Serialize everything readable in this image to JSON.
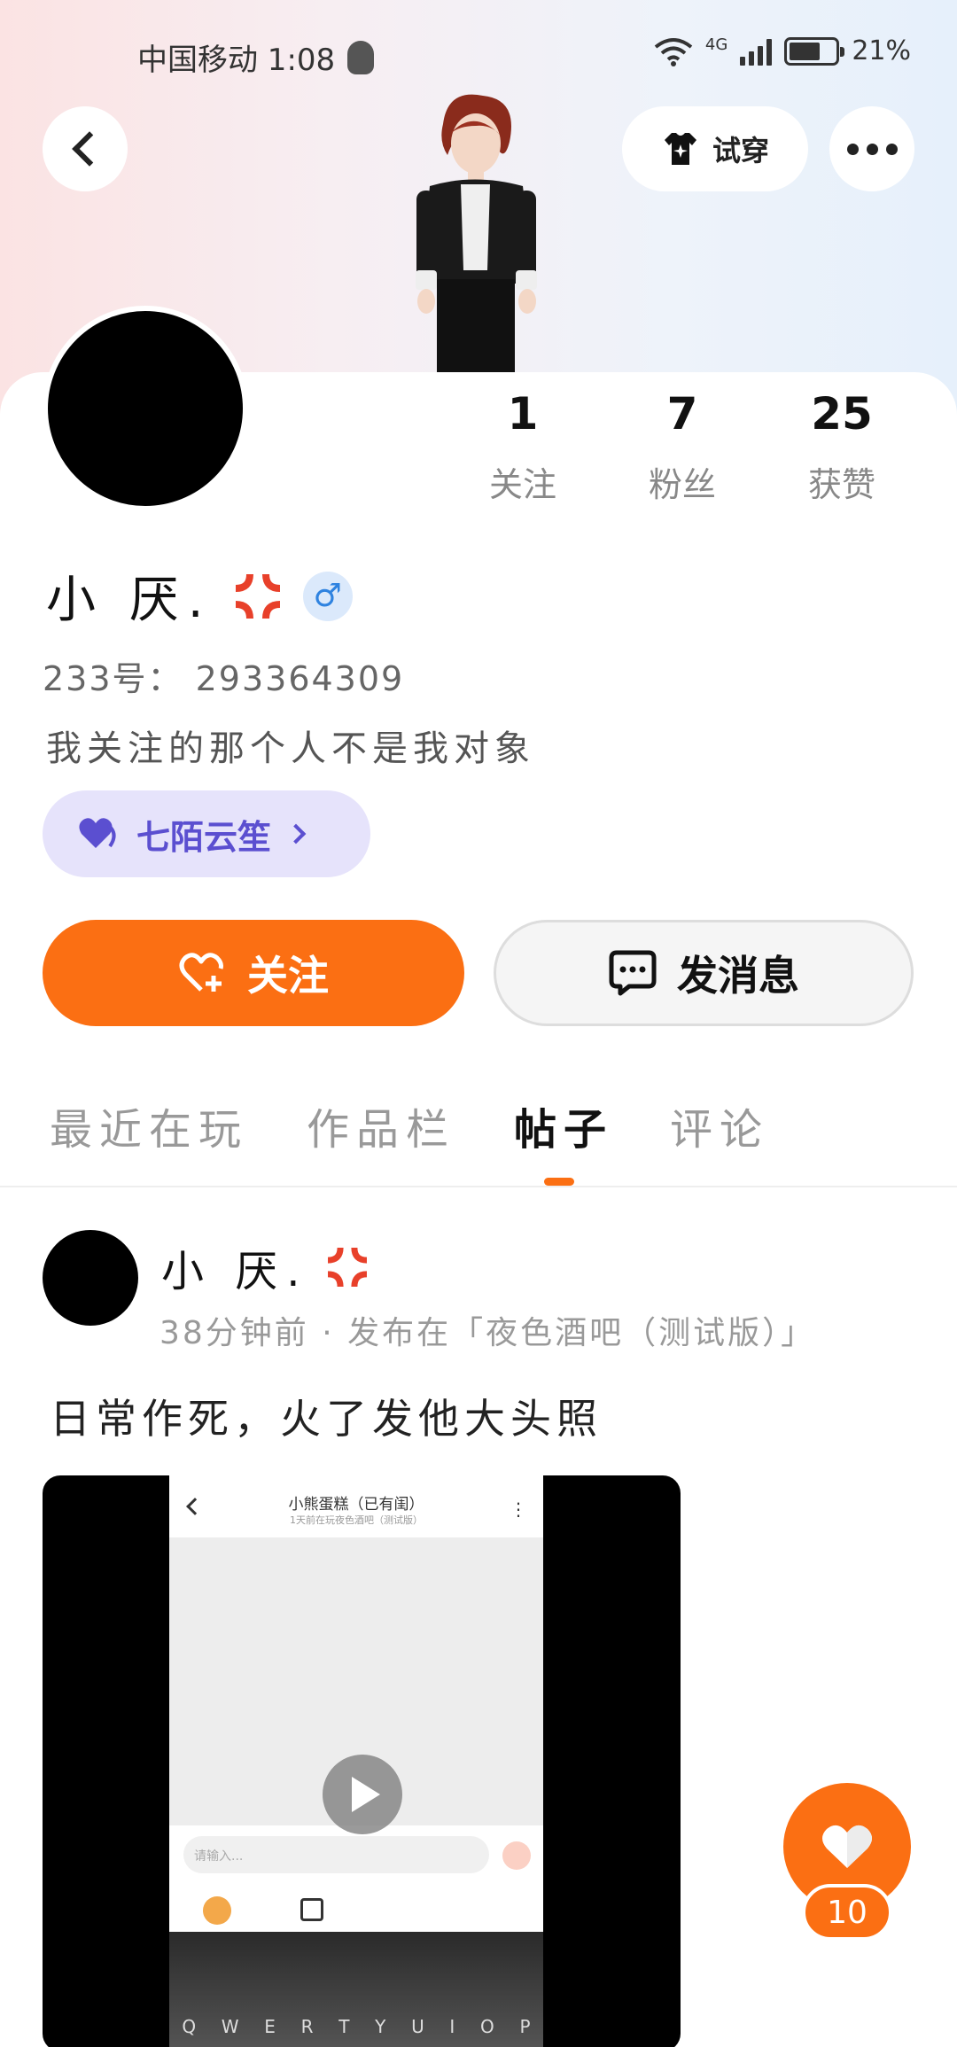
{
  "status_bar": {
    "carrier_time": "中国移动 1:08",
    "network": "4G",
    "battery": "21%"
  },
  "header": {
    "try_on_label": "试穿"
  },
  "profile": {
    "stats": [
      {
        "value": "1",
        "label": "关注"
      },
      {
        "value": "7",
        "label": "粉丝"
      },
      {
        "value": "25",
        "label": "获赞"
      }
    ],
    "nickname": "小 厌.",
    "gender_symbol": "♂",
    "uid_text": "233号： 293364309",
    "bio": "我关注的那个人不是我对象",
    "club_tag": "七陌云笙",
    "follow_label": "关注",
    "message_label": "发消息"
  },
  "tabs": [
    {
      "label": "最近在玩"
    },
    {
      "label": "作品栏"
    },
    {
      "label": "帖子"
    },
    {
      "label": "评论"
    }
  ],
  "post": {
    "author": "小 厌.",
    "meta": "38分钟前 · 发布在「夜色酒吧（测试版）」",
    "text": "日常作死，火了发他大头照",
    "video": {
      "screen_title": "小熊蛋糕（已有闺）",
      "screen_subtitle": "1天前在玩夜色酒吧（测试版）",
      "input_placeholder": "请输入...",
      "keyboard_row": [
        "Q",
        "W",
        "E",
        "R",
        "T",
        "Y",
        "U",
        "I",
        "O",
        "P"
      ]
    }
  },
  "like_fab": {
    "count": "10"
  },
  "colors": {
    "accent": "#fb6f13",
    "tag_bg": "#e6e3fb",
    "tag_text": "#5b4fd0",
    "gender": "#2f83e0"
  }
}
